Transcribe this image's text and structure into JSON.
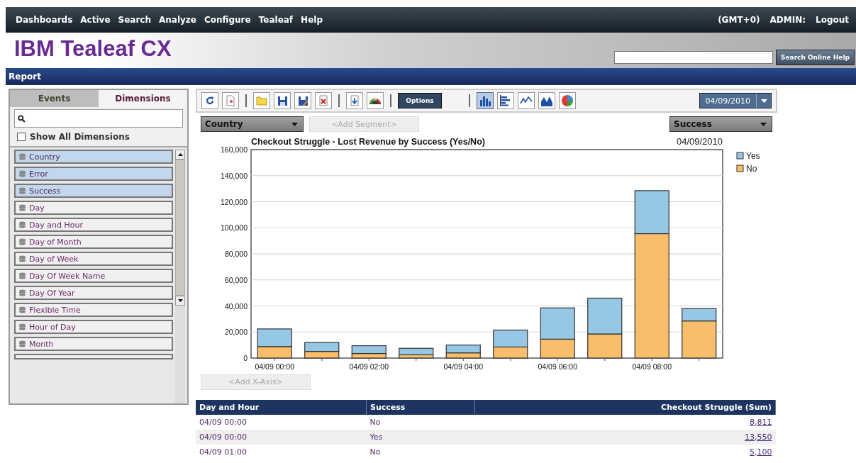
{
  "menu": [
    {
      "label": "Dashboards"
    },
    {
      "label": "Active"
    },
    {
      "label": "Search"
    },
    {
      "label": "Analyze"
    },
    {
      "label": "Configure"
    },
    {
      "label": "Tealeaf"
    },
    {
      "label": "Help"
    }
  ],
  "timezone": "(GMT+0)",
  "user": "ADMIN:",
  "logout": "Logout",
  "logo": "IBM Tealeaf CX",
  "help_button": "Search Online Help",
  "section": "Report",
  "sidebar": {
    "tabs": [
      {
        "label": "Events",
        "selected": false
      },
      {
        "label": "Dimensions",
        "selected": true
      }
    ],
    "show_all": {
      "label": "Show All Dimensions",
      "checked": false
    },
    "items": [
      {
        "label": "Country",
        "selected": true
      },
      {
        "label": "Error",
        "selected": true
      },
      {
        "label": "Success",
        "selected": true
      },
      {
        "label": "Day",
        "selected": false
      },
      {
        "label": "Day and Hour",
        "selected": false
      },
      {
        "label": "Day of Month",
        "selected": false
      },
      {
        "label": "Day of Week",
        "selected": false
      },
      {
        "label": "Day Of Week Name",
        "selected": false
      },
      {
        "label": "Day Of Year",
        "selected": false
      },
      {
        "label": "Flexible Time",
        "selected": false
      },
      {
        "label": "Hour of Day",
        "selected": false
      },
      {
        "label": "Month",
        "selected": false
      }
    ]
  },
  "toolbar": {
    "groups": [
      [
        {
          "kind": "refresh"
        },
        {
          "kind": "document"
        }
      ],
      [
        {
          "kind": "folder"
        },
        {
          "kind": "save"
        },
        {
          "kind": "save-as"
        },
        {
          "kind": "delete"
        }
      ],
      [
        {
          "kind": "export"
        },
        {
          "kind": "gauge"
        }
      ]
    ],
    "options": "Options",
    "chart_types": [
      {
        "kind": "bar",
        "selected": true
      },
      {
        "kind": "hbar",
        "selected": false
      },
      {
        "kind": "line",
        "selected": false
      },
      {
        "kind": "area",
        "selected": false
      },
      {
        "kind": "pie",
        "selected": false
      }
    ],
    "date": "04/09/2010"
  },
  "segment": {
    "dimension": "Country",
    "add_segment": "<Add Segment>",
    "measure": "Success"
  },
  "chart": {
    "date": "04/09/2010",
    "add_x_axis": "<Add X-Axis>",
    "chart_data": {
      "type": "bar",
      "stacked": true,
      "title": "Checkout Struggle - Lost Revenue by Success (Yes/No)",
      "categories": [
        "04/09 00:00",
        null,
        "04/09 02:00",
        null,
        "04/09 04:00",
        null,
        "04/09 06:00",
        null,
        "04/09 08:00",
        null
      ],
      "ylim": [
        0,
        160000
      ],
      "yticks": [
        {
          "value": 0,
          "label": "0"
        },
        {
          "value": 20000,
          "label": "20,000"
        },
        {
          "value": 40000,
          "label": "40,000"
        },
        {
          "value": 60000,
          "label": "60,000"
        },
        {
          "value": 80000,
          "label": "80,000"
        },
        {
          "value": 100000,
          "label": "100,000"
        },
        {
          "value": 120000,
          "label": "120,000"
        },
        {
          "value": 140000,
          "label": "140,000"
        },
        {
          "value": 160000,
          "label": "160,000"
        }
      ],
      "series": [
        {
          "name": "No",
          "color": "#f9be6a",
          "values": [
            8811,
            5100,
            3500,
            2500,
            4000,
            8500,
            14500,
            18500,
            95500,
            28500
          ]
        },
        {
          "name": "Yes",
          "color": "#96c8e6",
          "values": [
            13550,
            6900,
            6000,
            5000,
            6000,
            13000,
            24000,
            27500,
            33000,
            9500
          ]
        }
      ],
      "grid": true,
      "legend": "right"
    }
  },
  "table": {
    "columns": [
      "Day and Hour",
      "Success",
      "Checkout Struggle (Sum)"
    ],
    "rows": [
      [
        "04/09 00:00",
        "No",
        "8,811"
      ],
      [
        "04/09 00:00",
        "Yes",
        "13,550"
      ],
      [
        "04/09 01:00",
        "No",
        "5,100"
      ]
    ]
  }
}
